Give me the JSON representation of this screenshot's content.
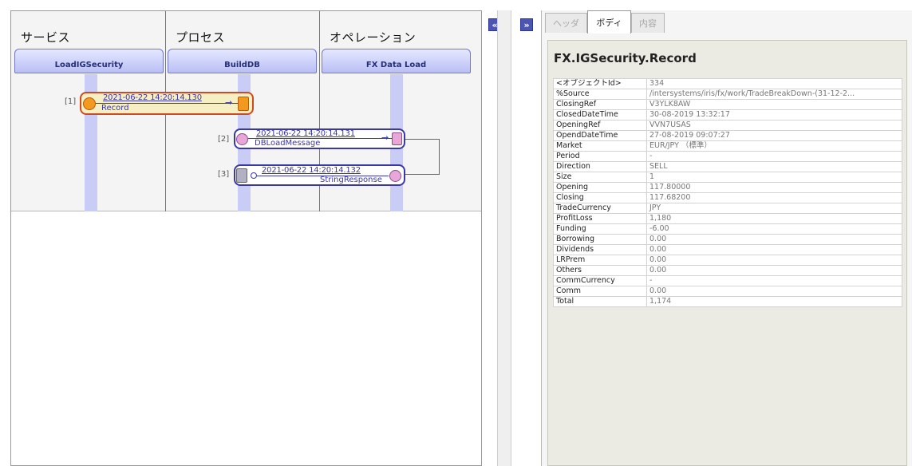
{
  "diagram": {
    "columns": [
      {
        "title": "サービス",
        "lane": "LoadIGSecurity"
      },
      {
        "title": "プロセス",
        "lane": "BuildDB"
      },
      {
        "title": "オペレーション",
        "lane": "FX Data Load"
      }
    ],
    "messages": [
      {
        "index": "[1]",
        "time": "2021-06-22 14:20:14.130",
        "name": "Record",
        "selected": true
      },
      {
        "index": "[2]",
        "time": "2021-06-22 14:20:14.131",
        "name": "DBLoadMessage",
        "selected": false
      },
      {
        "index": "[3]",
        "time": "2021-06-22 14:20:14.132",
        "name": "StringResponse",
        "selected": false
      }
    ],
    "arrow_glyph": "→"
  },
  "collapse_left_label": "«",
  "expand_right_label": "»",
  "tabs": [
    {
      "label": "ヘッダ",
      "active": false
    },
    {
      "label": "ボディ",
      "active": true
    },
    {
      "label": "内容",
      "active": false
    }
  ],
  "record": {
    "title": "FX.IGSecurity.Record",
    "rows": [
      {
        "key": "<オブジェクトId>",
        "value": "334"
      },
      {
        "key": "%Source",
        "value": "/intersystems/iris/fx/work/TradeBreakDown-(31-12-2..."
      },
      {
        "key": "ClosingRef",
        "value": "V3YLK8AW"
      },
      {
        "key": "ClosedDateTime",
        "value": "30-08-2019 13:32:17"
      },
      {
        "key": "OpeningRef",
        "value": "VVN7USAS"
      },
      {
        "key": "OpendDateTime",
        "value": "27-08-2019 09:07:27"
      },
      {
        "key": "Market",
        "value": "EUR/JPY （標準）"
      },
      {
        "key": "Period",
        "value": "-"
      },
      {
        "key": "Direction",
        "value": "SELL"
      },
      {
        "key": "Size",
        "value": "1"
      },
      {
        "key": "Opening",
        "value": "117.80000"
      },
      {
        "key": "Closing",
        "value": "117.68200"
      },
      {
        "key": "TradeCurrency",
        "value": "JPY"
      },
      {
        "key": "ProfitLoss",
        "value": "1,180"
      },
      {
        "key": "Funding",
        "value": "-6.00"
      },
      {
        "key": "Borrowing",
        "value": "0.00"
      },
      {
        "key": "Dividends",
        "value": "0.00"
      },
      {
        "key": "LRPrem",
        "value": "0.00"
      },
      {
        "key": "Others",
        "value": "0.00"
      },
      {
        "key": "CommCurrency",
        "value": "-"
      },
      {
        "key": "Comm",
        "value": "0.00"
      },
      {
        "key": "Total",
        "value": "1,174"
      }
    ]
  },
  "colors": {
    "accent": "#3a37a6",
    "selection_border": "#cf4a1f",
    "selection_fill": "#f7efc4",
    "node_orange": "#f39a1e",
    "node_pink": "#e8a7d8",
    "lane_fill": "#c9ccf4"
  }
}
